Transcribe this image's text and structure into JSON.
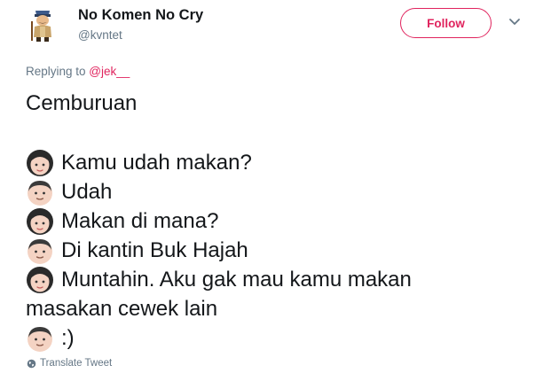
{
  "user": {
    "display_name": "No Komen No Cry",
    "handle": "@kvntet"
  },
  "follow_button": {
    "label": "Follow"
  },
  "reply": {
    "prefix": "Replying to ",
    "mention": "@jek__"
  },
  "tweet": {
    "first_line": "Cemburuan",
    "lines": [
      {
        "speaker_icon": "woman-face-emoji",
        "text": "Kamu udah makan?"
      },
      {
        "speaker_icon": "man-face-emoji",
        "text": "Udah"
      },
      {
        "speaker_icon": "woman-face-emoji",
        "text": "Makan di mana?"
      },
      {
        "speaker_icon": "man-face-emoji",
        "text": "Di kantin Buk Hajah"
      },
      {
        "speaker_icon": "woman-face-emoji",
        "text": "Muntahin. Aku gak mau kamu makan"
      },
      {
        "speaker_icon": "",
        "text": "masakan cewek lain"
      },
      {
        "speaker_icon": "man-face-emoji",
        "text": ":)"
      }
    ]
  },
  "translate": {
    "label": "Translate Tweet",
    "icon": "globe-icon"
  },
  "colors": {
    "accent": "#e0245e",
    "text": "#14171a",
    "secondary_text": "#657786"
  }
}
